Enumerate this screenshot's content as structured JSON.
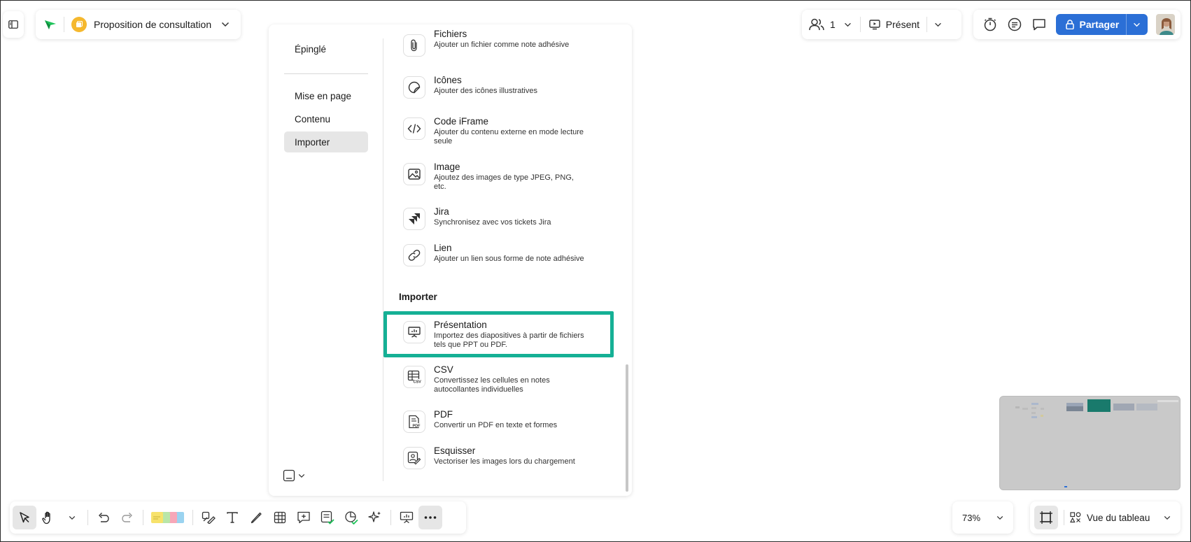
{
  "header": {
    "board_title": "Proposition de consultation",
    "collaborators_count": "1",
    "present_label": "Présent",
    "share_label": "Partager"
  },
  "panel": {
    "nav": {
      "pinned": "Épinglé",
      "layout": "Mise en page",
      "content": "Contenu",
      "import": "Importer"
    },
    "items": [
      {
        "title": "Fichiers",
        "desc": "Ajouter un fichier comme note adhésive",
        "icon": "paperclip-icon"
      },
      {
        "title": "Icônes",
        "desc": "Ajouter des icônes illustratives",
        "icon": "sticker-icon"
      },
      {
        "title": "Code iFrame",
        "desc": "Ajouter du contenu externe en mode lecture seule",
        "icon": "code-icon"
      },
      {
        "title": "Image",
        "desc": "Ajoutez des images de type JPEG, PNG, etc.",
        "icon": "image-icon"
      },
      {
        "title": "Jira",
        "desc": "Synchronisez avec vos tickets Jira",
        "icon": "jira-icon"
      },
      {
        "title": "Lien",
        "desc": "Ajouter un lien sous forme de note adhésive",
        "icon": "link-icon"
      }
    ],
    "import_section_title": "Importer",
    "import_items": [
      {
        "title": "Présentation",
        "desc": "Importez des diapositives à partir de fichiers tels que PPT ou PDF.",
        "icon": "presentation-icon"
      },
      {
        "title": "CSV",
        "desc": "Convertissez les cellules en notes autocollantes individuelles",
        "icon": "csv-icon"
      },
      {
        "title": "PDF",
        "desc": "Convertir un PDF en texte et formes",
        "icon": "pdf-icon"
      },
      {
        "title": "Esquisser",
        "desc": "Vectoriser les images lors du chargement",
        "icon": "sketch-icon"
      }
    ]
  },
  "footer": {
    "zoom": "73%",
    "board_view_label": "Vue du tableau"
  },
  "colors": {
    "accent": "#2b6fd6",
    "highlight": "#15b095",
    "board_badge": "#f5b82e",
    "logo": "#1ec35a"
  }
}
